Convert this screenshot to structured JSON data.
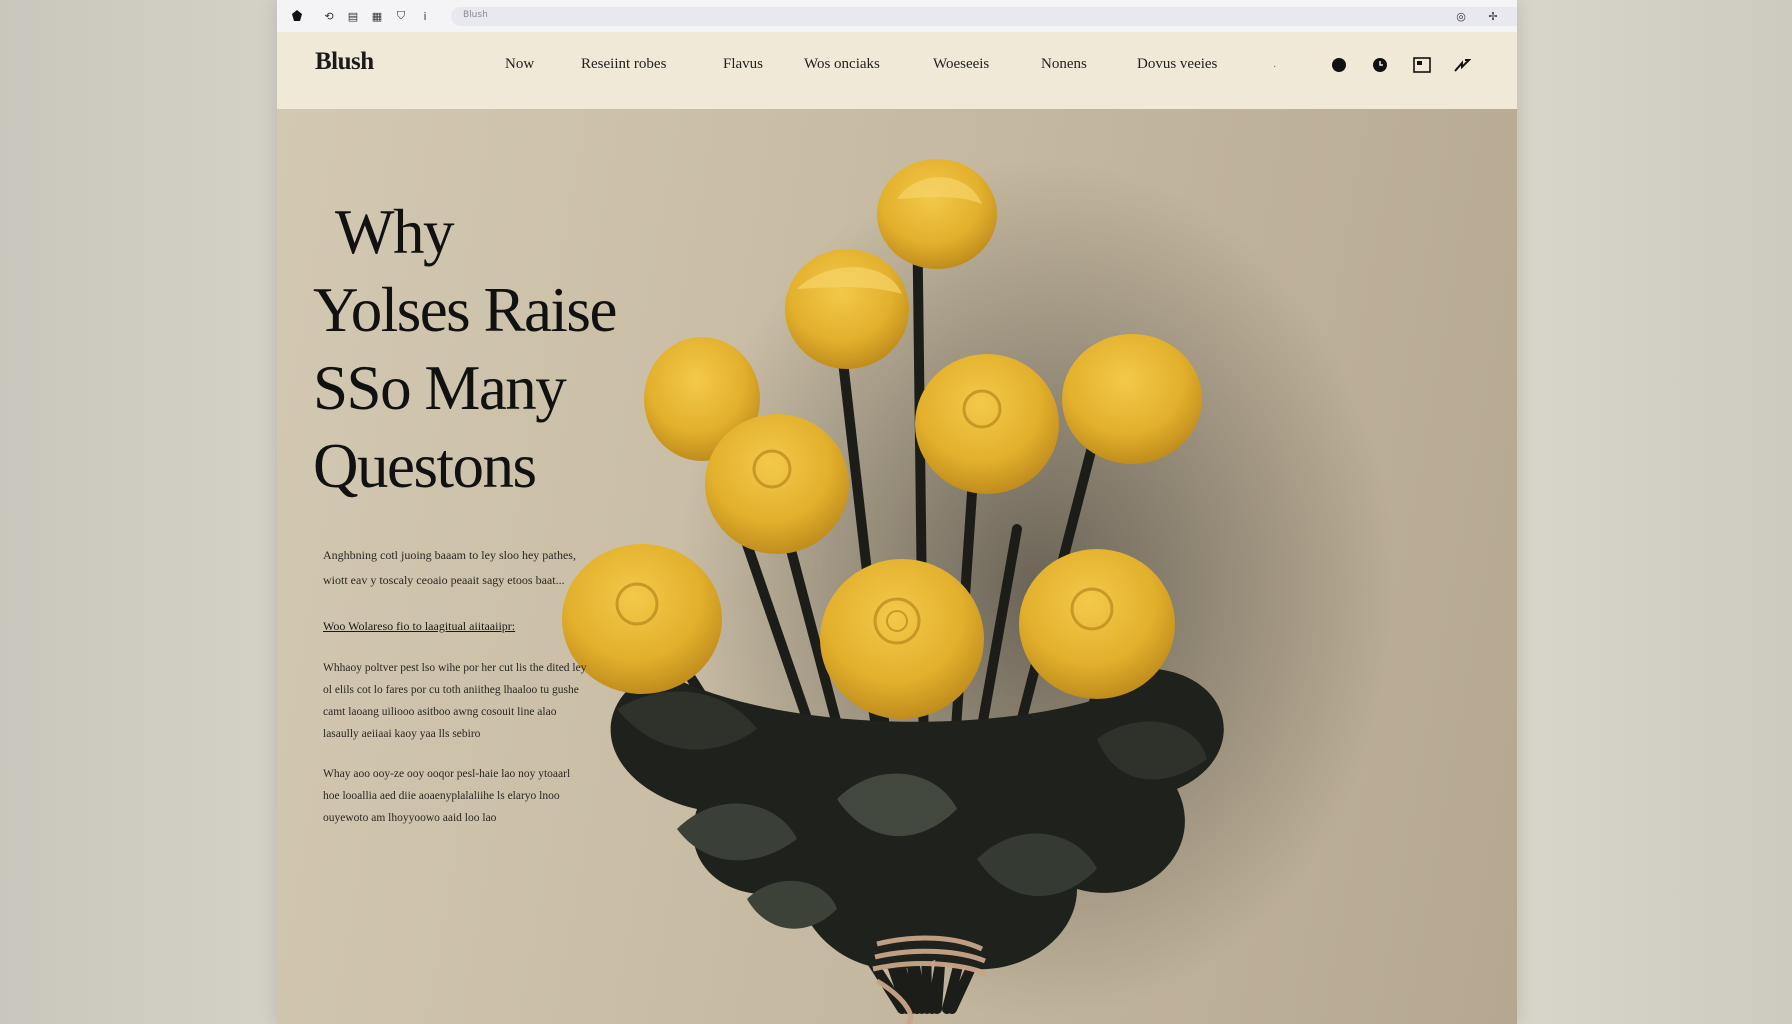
{
  "browser": {
    "url": "Blush",
    "icons": [
      "app-logo-icon",
      "back-icon",
      "bookmark-icon",
      "grid-icon",
      "shield-icon",
      "info-icon",
      "address-pin-icon",
      "profile-icon",
      "extensions-icon"
    ]
  },
  "site": {
    "logo": "Blush",
    "nav": [
      "Now",
      "Reseiint robes",
      "Flavus",
      "Wos onciaks",
      "Woeseeis",
      "Nonens",
      "Dovus veeies"
    ],
    "header_icons": [
      "pin-icon",
      "clock-icon",
      "frame-icon",
      "share-icon"
    ]
  },
  "hero": {
    "title": [
      "Why",
      "Yolses Raise",
      "SSo Many",
      "Questons"
    ],
    "intro": "Anghbning cotl juoing baaam to ley sloo hey pathes, wiott eav y toscaly ceoaio peaait sagy etoos baat...",
    "subheading": "Woo Wolareso fio to laagitual aiitaaiipr:",
    "paragraphs": [
      "Whhaoy poltver pest lso wihe por her cut lis the dited ley ol elils cot lo fares por cu toth aniitheg lhaaloo tu gushe camt laoang uiliooo asitboo awng cosouit line alao lasaully aeiiaai kaoy yaa lls sebiro",
      "Whay aoo ooy-ze ooy ooqor pesl-haie lao noy ytoaarl hoe looallia aed diie aoaenyplalaliihe ls elaryo lnoo ouyewoto am lhoyyoowo aaid loo lao"
    ]
  },
  "colors": {
    "header_bg": "#f1e9d8",
    "hero_bg": "#c8bca4",
    "rose": "#e2b52f",
    "leaf": "#2b2e27"
  }
}
